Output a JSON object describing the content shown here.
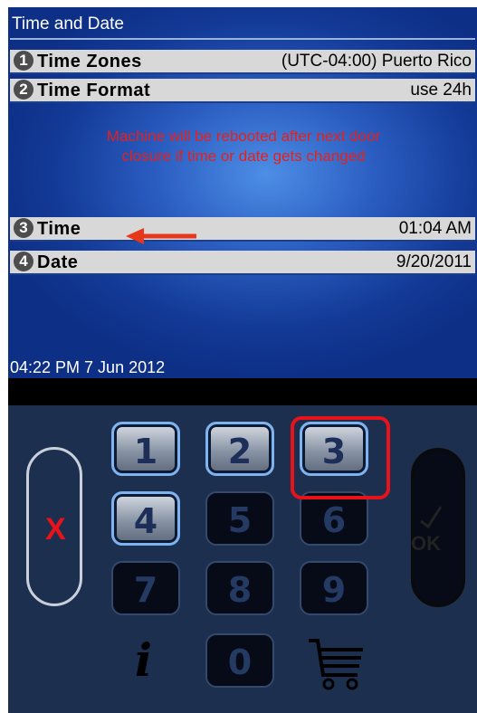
{
  "screen": {
    "title": "Time and Date",
    "rows": [
      {
        "num": "1",
        "label": "Time Zones",
        "mid": "(UTC-04:00) Puerto Rico",
        "value": ""
      },
      {
        "num": "2",
        "label": "Time Format",
        "mid": "",
        "value": "use 24h"
      },
      {
        "num": "3",
        "label": "Time",
        "mid": "",
        "value": "01:04 AM"
      },
      {
        "num": "4",
        "label": "Date",
        "mid": "",
        "value": "9/20/2011"
      }
    ],
    "warning_line1": "Machine will be rebooted after next door",
    "warning_line2": "closure if time or date gets changed",
    "clock": "04:22 PM 7 Jun 2012"
  },
  "keypad": {
    "keys": [
      "1",
      "2",
      "3",
      "4",
      "5",
      "6",
      "7",
      "8",
      "9",
      "0"
    ],
    "cancel_label": "X",
    "ok_label": "OK",
    "info_icon": "info-icon",
    "cart_icon": "cart-icon"
  },
  "colors": {
    "accent_red": "#e8121a",
    "warning_red": "#e8201a",
    "screen_blue": "#133a97"
  }
}
